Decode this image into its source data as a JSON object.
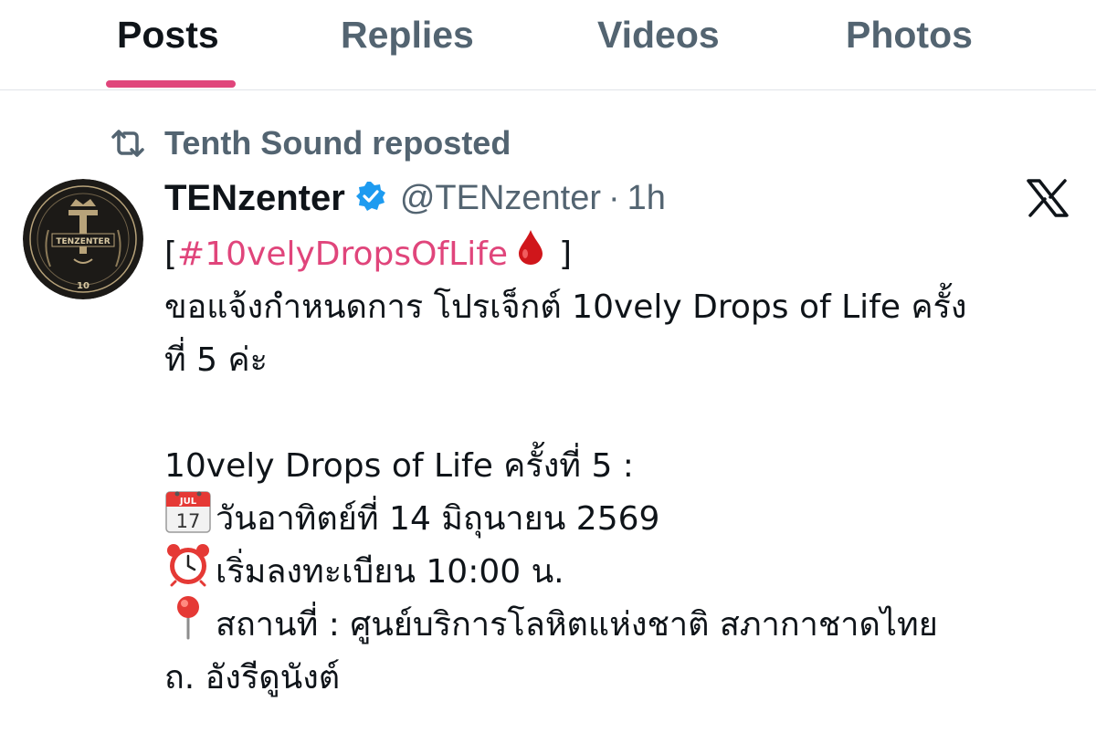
{
  "tabs": [
    {
      "label": "Posts",
      "active": true
    },
    {
      "label": "Replies",
      "active": false
    },
    {
      "label": "Videos",
      "active": false
    },
    {
      "label": "Photos",
      "active": false
    }
  ],
  "colors": {
    "accent": "#e0457b",
    "muted": "#536471",
    "text": "#0f1419",
    "verified": "#1d9bf0"
  },
  "repost": {
    "icon": "repost-icon",
    "text": "Tenth Sound reposted"
  },
  "post": {
    "avatar": {
      "icon": "tenzenter-logo",
      "logo_text": "TENZENTER",
      "logo_number": "10"
    },
    "display_name": "TENzenter",
    "verified": true,
    "handle": "@TENzenter",
    "separator": "·",
    "time": "1h",
    "platform_icon": "x-logo-icon",
    "hashtag_open": "[",
    "hashtag": "#10velyDropsOfLife",
    "hashtag_emoji": "drop-of-blood-icon",
    "hashtag_close": "]",
    "text_line1": "ขอแจ้งกำหนดการ โปรเจ็กต์ 10vely Drops of Life ครั้ง",
    "text_line2": "ที่ 5 ค่ะ",
    "event_title": "10vely Drops of Life ครั้งที่ 5  :",
    "calendar_month": "JUL",
    "calendar_day": "17",
    "date_text": "วันอาทิตย์ที่ 14 มิถุนายน 2569",
    "time_text": "เริ่มลงทะเบียน 10:00 น.",
    "location_text": "สถานที่ : ศูนย์บริการโลหิตแห่งชาติ สภากาชาดไทย",
    "location_line2": "ถ. อังรีดูนังต์",
    "icons": {
      "date": "calendar-icon",
      "time": "alarm-clock-icon",
      "location": "pushpin-icon"
    }
  }
}
